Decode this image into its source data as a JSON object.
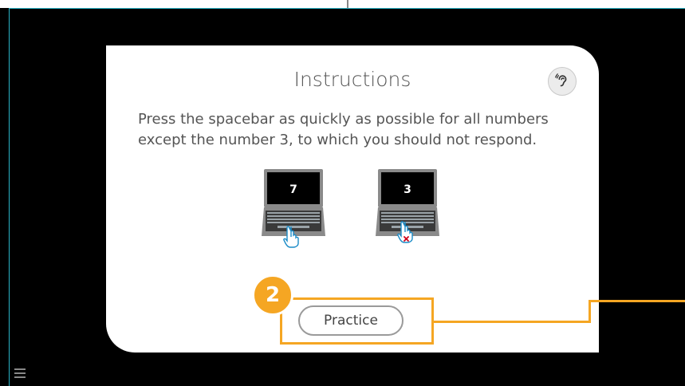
{
  "instructions": {
    "title": "Instructions",
    "body": "Press the spacebar as quickly as possible for all numbers except the number 3, to which you should not respond.",
    "audio_icon": "ear-icon"
  },
  "examples": [
    {
      "number": "7",
      "action_icon": "tap-hand-icon",
      "outcome": "respond"
    },
    {
      "number": "3",
      "action_icon": "no-tap-hand-icon",
      "outcome": "do-not-respond"
    }
  ],
  "practice": {
    "label": "Practice"
  },
  "callout": {
    "step": "2",
    "color": "#f5a623"
  },
  "menu": {
    "icon": "hamburger-menu-icon"
  }
}
